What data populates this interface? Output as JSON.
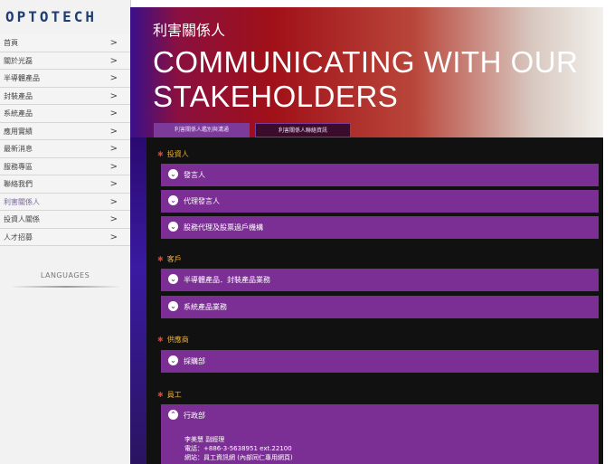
{
  "sidebar": {
    "logo": "OPTOTECH",
    "items": [
      {
        "label": "首頁"
      },
      {
        "label": "關於光磊"
      },
      {
        "label": "半導體產品"
      },
      {
        "label": "封裝產品"
      },
      {
        "label": "系統產品"
      },
      {
        "label": "應用實績"
      },
      {
        "label": "最新消息"
      },
      {
        "label": "服務專區"
      },
      {
        "label": "聯絡我們"
      },
      {
        "label": "利害關係人"
      },
      {
        "label": "投資人關係"
      },
      {
        "label": "人才招募"
      }
    ],
    "chevron": ">",
    "languages_label": "LANGUAGES"
  },
  "banner": {
    "title_cn": "利害關係人",
    "title_en": "COMMUNICATING WITH OUR STAKEHOLDERS"
  },
  "tabs": [
    {
      "label": "利害關係人鑑別與溝通"
    },
    {
      "label": "利害關係人聯絡資訊"
    }
  ],
  "sections": {
    "investors": {
      "heading": "投資人",
      "items": [
        "發言人",
        "代理發言人",
        "股務代理及股票過戶機構"
      ]
    },
    "customers": {
      "heading": "客戶",
      "items": [
        "半導體產品．封裝產品業務",
        "系統產品業務"
      ]
    },
    "suppliers": {
      "heading": "供應商",
      "items": [
        "採購部"
      ]
    },
    "employees": {
      "heading": "員工",
      "items": [
        "行政部"
      ],
      "details": [
        "李美慧 副經理",
        "電話：+886-3-5638951 ext.22100",
        "網站：員工資訊網 (內部同仁專用網頁)"
      ]
    }
  },
  "icons": {
    "accordion_collapsed": "chevron-down-icon",
    "accordion_expanded": "chevron-up-icon",
    "section_marker": "star-icon"
  },
  "colors": {
    "logo": "#1f3e72",
    "accordion": "#7b2e94",
    "section_heading": "#e8b040",
    "marker": "#e04030"
  }
}
